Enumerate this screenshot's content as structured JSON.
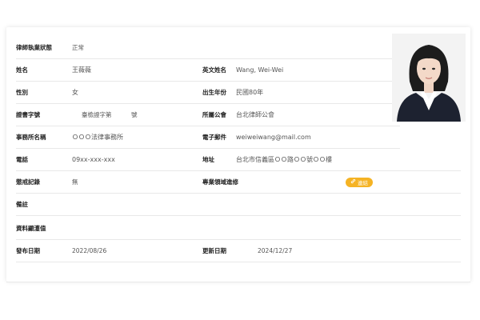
{
  "status": {
    "label": "律師執業狀態",
    "value": "正常"
  },
  "name": {
    "label": "姓名",
    "value": "王薇薇"
  },
  "english_name": {
    "label": "英文姓名",
    "value": "Wang, Wei-Wei"
  },
  "gender": {
    "label": "性別",
    "value": "女"
  },
  "birth_year": {
    "label": "出生年份",
    "value": "民國80年"
  },
  "license": {
    "label": "證書字號",
    "value": "臺檢證字第",
    "suffix": "號"
  },
  "bar_association": {
    "label": "所屬公會",
    "value": "台北律師公會"
  },
  "firm": {
    "label": "事務所名稱",
    "value": "ＯＯＯ法律事務所"
  },
  "email": {
    "label": "電子郵件",
    "value": "weiweiwang@mail.com"
  },
  "phone": {
    "label": "電話",
    "value": "09xx-xxx-xxx"
  },
  "address": {
    "label": "地址",
    "value": "台北市信義區ＯＯ路ＯＯ號ＯＯ樓"
  },
  "discipline": {
    "label": "懲戒記錄",
    "value": "無"
  },
  "specialty": {
    "label": "專業領域進修",
    "tag": "連結",
    "tag_icon": "link-icon",
    "tag_color": "#f5b324"
  },
  "remarks": {
    "label": "備註"
  },
  "source": {
    "label": "資料顯濩值"
  },
  "publish_date": {
    "label": "發布日期",
    "value": "2022/08/26"
  },
  "update_date": {
    "label": "更新日期",
    "value": "2024/12/27"
  },
  "photo": {
    "icon": "lawyer-portrait-photo"
  }
}
